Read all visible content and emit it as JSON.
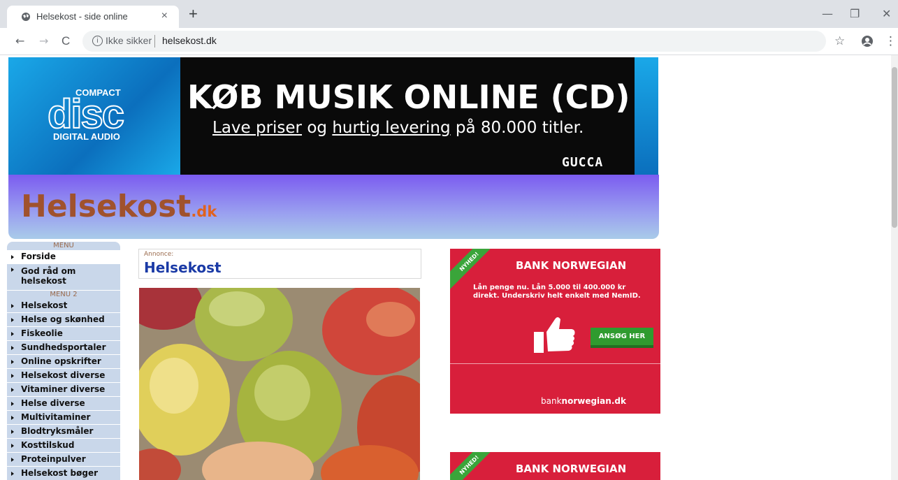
{
  "browser": {
    "tab_title": "Helsekost - side online",
    "tab_close": "×",
    "new_tab": "+",
    "security_label": "Ikke sikker",
    "url": "helsekost.dk",
    "window_minimize": "—",
    "window_restore": "❐",
    "window_close": "✕",
    "back": "←",
    "forward": "→",
    "reload": "C",
    "bookmark": "☆",
    "menu": "⋮"
  },
  "banner": {
    "compact": "COMPACT",
    "disc": "disc",
    "digital_audio": "DIGITAL AUDIO",
    "headline": "KØB MUSIK ONLINE (CD)",
    "sub_part1": "Lave priser",
    "sub_part2": " og ",
    "sub_part3": "hurtig levering",
    "sub_part4": " på 80.000 titler.",
    "brand": "GUCCA"
  },
  "site": {
    "logo_main": "Helsekost",
    "logo_suffix": ".dk"
  },
  "menu": {
    "heading1": "MENU",
    "heading2": "MENU 2",
    "items1": [
      "Forside",
      "God råd om helsekost"
    ],
    "items2": [
      "Helsekost",
      "Helse og skønhed",
      "Fiskeolie",
      "Sundhedsportaler",
      "Online opskrifter",
      "Helsekost diverse",
      "Vitaminer diverse",
      "Helse diverse",
      "Multivitaminer",
      "Blodtryksmåler",
      "Kosttilskud",
      "Proteinpulver",
      "Helsekost bøger"
    ]
  },
  "content": {
    "annonce_label": "Annonce:",
    "annonce_title": "Helsekost"
  },
  "ads": [
    {
      "ribbon": "NYHED!",
      "title": "BANK NORWEGIAN",
      "text": "Lån penge nu. Lån 5.000 til 400.000 kr direkt. Underskriv helt enkelt med NemID.",
      "cta": "ANSØG HER",
      "domain_bank": "bank",
      "domain_norwegian": "norwegian",
      "domain_dk": ".dk"
    },
    {
      "ribbon": "NYHED!",
      "title": "BANK NORWEGIAN"
    }
  ],
  "colors": {
    "ad_red": "#d81f3b",
    "cta_green": "#2f9b2f",
    "logo_brown": "#a0522d",
    "annonce_blue": "#1a3aa6"
  }
}
